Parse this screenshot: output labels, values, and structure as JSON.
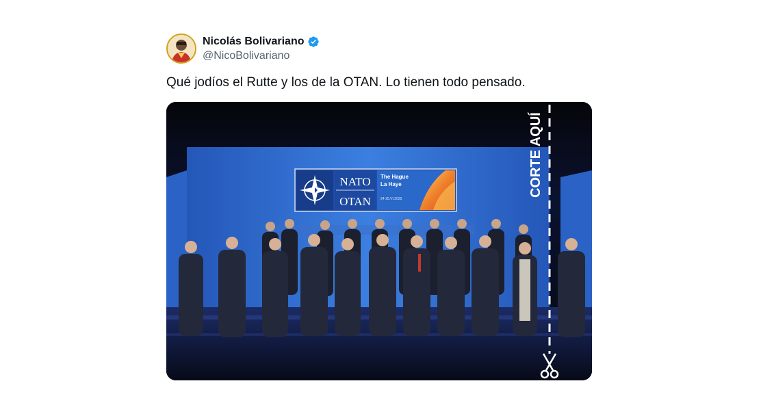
{
  "author": {
    "name": "Nicolás Bolivariano",
    "handle": "@NicoBolivariano",
    "verified_icon": "verified-badge-icon"
  },
  "tweet": {
    "text": "Qué jodíos el Rutte y los de la OTAN. Lo tienen todo pensado."
  },
  "media": {
    "banner": {
      "nato": "NATO",
      "otan": "OTAN",
      "city_en": "The Hague",
      "city_fr": "La Haye",
      "date": "24-25.VI.2025"
    },
    "cut_label": "CORTE AQUÍ",
    "scissors_icon": "scissors-icon",
    "colors": {
      "stage_blue": "#2f6fd6",
      "banner_orange": "#f0822a",
      "cut_line": "#ffffff"
    }
  }
}
